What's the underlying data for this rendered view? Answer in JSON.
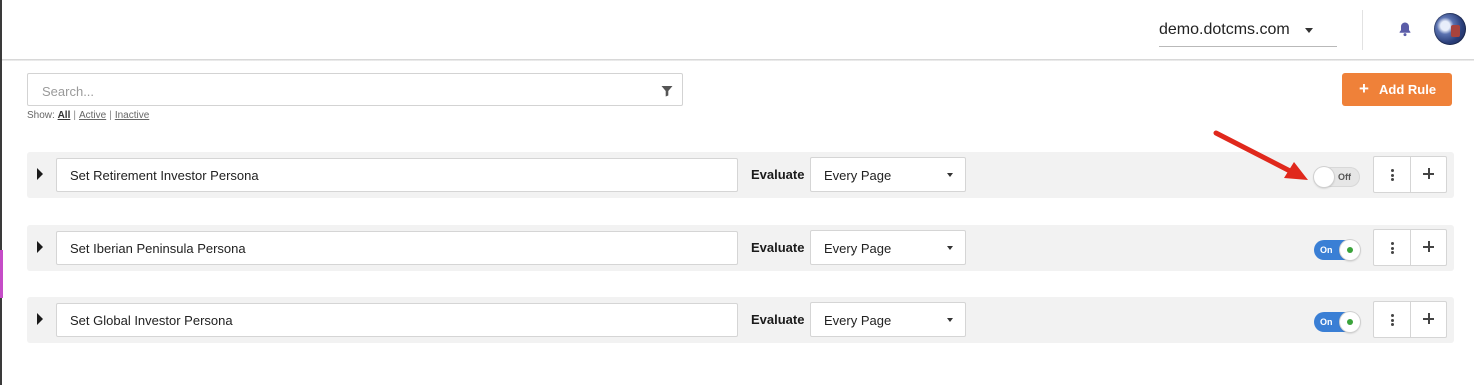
{
  "header": {
    "site_selector": "demo.dotcms.com",
    "icons": [
      "bell-icon",
      "avatar"
    ]
  },
  "search": {
    "placeholder": "Search...",
    "show_label": "Show:",
    "filters": [
      "All",
      "Active",
      "Inactive"
    ],
    "selected_filter": "All"
  },
  "add_rule_button": {
    "icon": "plus-icon",
    "label": "Add Rule"
  },
  "rules": [
    {
      "name": "Set Retirement Investor Persona",
      "evaluate_label": "Evaluate",
      "evaluate_value": "Every Page",
      "toggle_label": "Off",
      "enabled": false
    },
    {
      "name": "Set Iberian Peninsula Persona",
      "evaluate_label": "Evaluate",
      "evaluate_value": "Every Page",
      "toggle_label": "On",
      "enabled": true
    },
    {
      "name": "Set Global Investor Persona",
      "evaluate_label": "Evaluate",
      "evaluate_value": "Every Page",
      "toggle_label": "On",
      "enabled": true
    }
  ],
  "colors": {
    "accent_orange": "#ef8139",
    "toggle_on_blue": "#3a7fd5",
    "annotation_red": "#e0281c"
  }
}
